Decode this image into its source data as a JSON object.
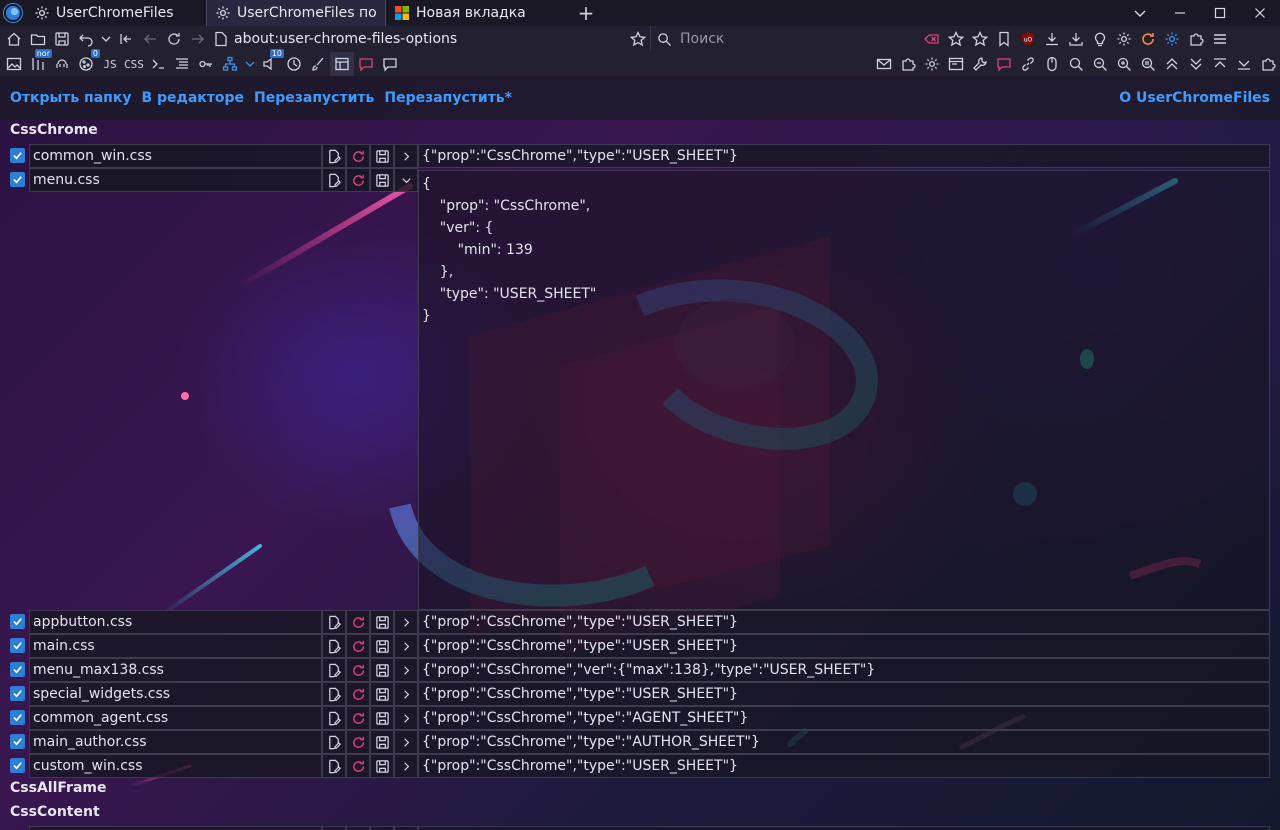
{
  "tabs": [
    {
      "label": "UserChromeFiles",
      "active": false,
      "icon": "gear-icon"
    },
    {
      "label": "UserChromeFiles подк",
      "active": true,
      "icon": "gear-icon"
    },
    {
      "label": "Новая вкладка",
      "active": false,
      "icon": "windows-logo-icon"
    }
  ],
  "navbar": {
    "url": "about:user-chrome-files-options",
    "search_placeholder": "Поиск"
  },
  "toolbar2": {
    "badge_nor": "nor",
    "badge_zero": "0",
    "label_js": "JS",
    "label_css": "CSS",
    "badge_ten": "10"
  },
  "actions": {
    "open_folder": "Открыть папку",
    "in_editor": "В редакторе",
    "restart": "Перезапустить",
    "restart_star": "Перезапустить*",
    "about": "О UserChromeFiles"
  },
  "sections": {
    "css_chrome": "CssChrome",
    "css_all_frame": "CssAllFrame",
    "css_content": "CssContent"
  },
  "files": [
    {
      "name": "common_win.css",
      "json": "{\"prop\":\"CssChrome\",\"type\":\"USER_SHEET\"}",
      "checked": true,
      "expanded": false
    },
    {
      "name": "menu.css",
      "json": "",
      "checked": true,
      "expanded": true
    },
    {
      "name": "appbutton.css",
      "json": "{\"prop\":\"CssChrome\",\"type\":\"USER_SHEET\"}",
      "checked": true,
      "expanded": false
    },
    {
      "name": "main.css",
      "json": "{\"prop\":\"CssChrome\",\"type\":\"USER_SHEET\"}",
      "checked": true,
      "expanded": false
    },
    {
      "name": "menu_max138.css",
      "json": "{\"prop\":\"CssChrome\",\"ver\":{\"max\":138},\"type\":\"USER_SHEET\"}",
      "checked": true,
      "expanded": false
    },
    {
      "name": "special_widgets.css",
      "json": "{\"prop\":\"CssChrome\",\"type\":\"USER_SHEET\"}",
      "checked": true,
      "expanded": false
    },
    {
      "name": "common_agent.css",
      "json": "{\"prop\":\"CssChrome\",\"type\":\"AGENT_SHEET\"}",
      "checked": true,
      "expanded": false
    },
    {
      "name": "main_author.css",
      "json": "{\"prop\":\"CssChrome\",\"type\":\"AUTHOR_SHEET\"}",
      "checked": true,
      "expanded": false
    },
    {
      "name": "custom_win.css",
      "json": "{\"prop\":\"CssChrome\",\"type\":\"USER_SHEET\"}",
      "checked": true,
      "expanded": false
    }
  ],
  "expanded_json": "{\n    \"prop\": \"CssChrome\",\n    \"ver\": {\n        \"min\": 139\n    },\n    \"type\": \"USER_SHEET\"\n}",
  "colors": {
    "accent": "#3f9cff",
    "checkbox": "#2d7fd6",
    "reload": "#e0407a"
  }
}
